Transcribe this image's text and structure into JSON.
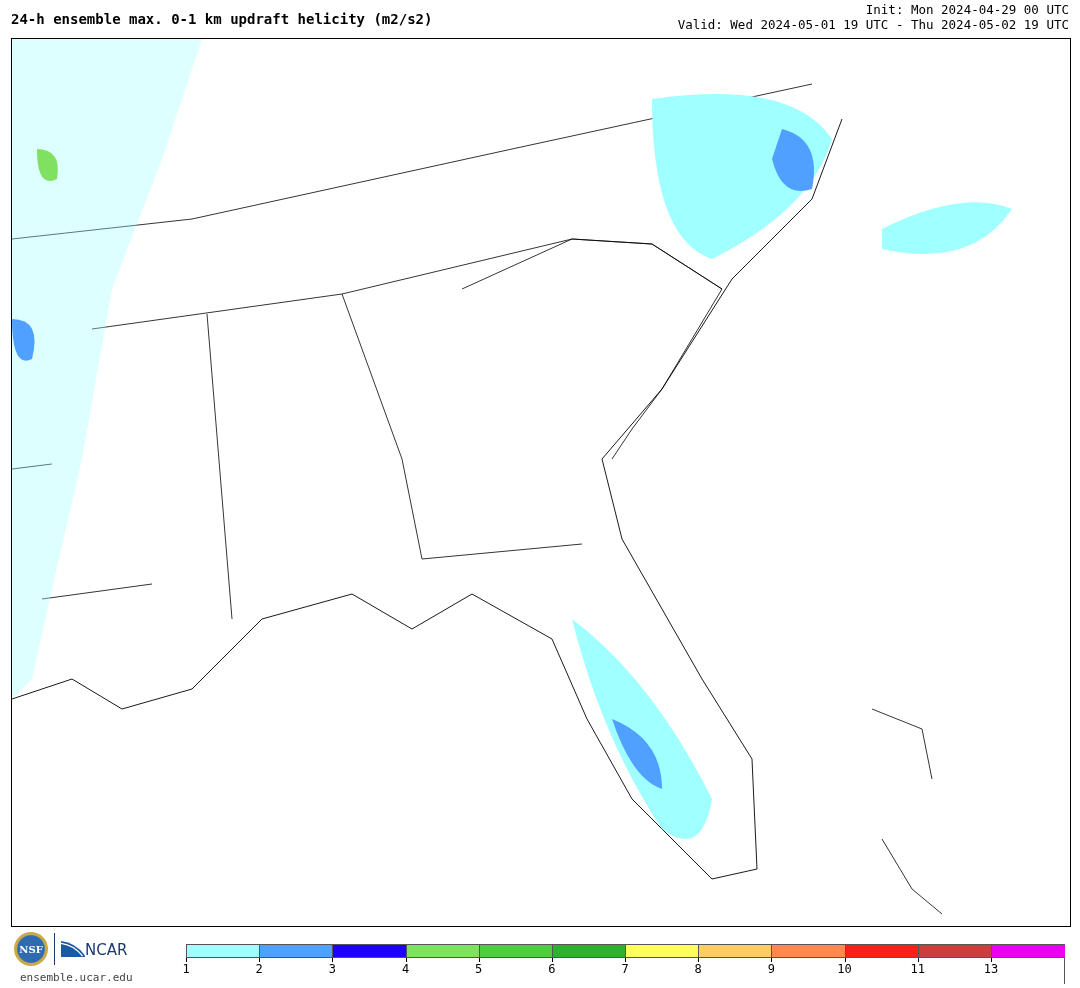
{
  "header": {
    "title": "24-h ensemble max. 0-1 km updraft helicity (m2/s2)",
    "init": "Init: Mon 2024-04-29 00 UTC",
    "valid": "Valid: Wed 2024-05-01 19 UTC - Thu 2024-05-02 19 UTC"
  },
  "footer": {
    "nsf_logo": "NSF",
    "ncar_logo": "NCAR",
    "url": "ensemble.ucar.edu"
  },
  "colorbar": [
    {
      "label": "1",
      "color": "#a0ffff"
    },
    {
      "label": "2",
      "color": "#50a0ff"
    },
    {
      "label": "3",
      "color": "#1e00ff"
    },
    {
      "label": "4",
      "color": "#80e060"
    },
    {
      "label": "5",
      "color": "#50cc40"
    },
    {
      "label": "6",
      "color": "#30b030"
    },
    {
      "label": "7",
      "color": "#ffff60"
    },
    {
      "label": "8",
      "color": "#ffcc66"
    },
    {
      "label": "9",
      "color": "#ff8850"
    },
    {
      "label": "10",
      "color": "#ff1e1e"
    },
    {
      "label": "11",
      "color": "#cc3e3e"
    },
    {
      "label": "13",
      "color": "#ee00ee"
    }
  ]
}
